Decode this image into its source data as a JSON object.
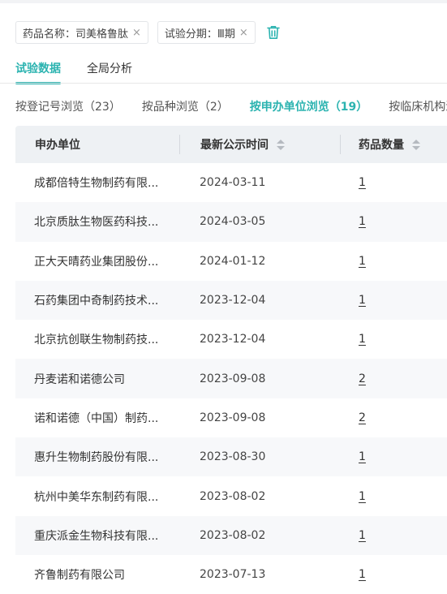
{
  "filters": [
    {
      "label": "药品名称：司美格鲁肽"
    },
    {
      "label": "试验分期：Ⅲ期"
    }
  ],
  "close_glyph": "×",
  "tabs": [
    {
      "label": "试验数据",
      "active": true
    },
    {
      "label": "全局分析",
      "active": false
    }
  ],
  "subtabs": [
    {
      "label": "按登记号浏览（23）"
    },
    {
      "label": "按品种浏览（2）"
    },
    {
      "label": "按申办单位浏览（19）"
    },
    {
      "label": "按临床机构浏览"
    }
  ],
  "table": {
    "columns": [
      "申办单位",
      "最新公示时间",
      "药品数量"
    ],
    "rows": [
      {
        "sponsor": "成都倍特生物制药有限...",
        "date": "2024-03-11",
        "count": "1"
      },
      {
        "sponsor": "北京质肽生物医药科技...",
        "date": "2024-03-05",
        "count": "1"
      },
      {
        "sponsor": "正大天晴药业集团股份...",
        "date": "2024-01-12",
        "count": "1"
      },
      {
        "sponsor": "石药集团中奇制药技术...",
        "date": "2023-12-04",
        "count": "1"
      },
      {
        "sponsor": "北京抗创联生物制药技...",
        "date": "2023-12-04",
        "count": "1"
      },
      {
        "sponsor": "丹麦诺和诺德公司",
        "date": "2023-09-08",
        "count": "2"
      },
      {
        "sponsor": "诺和诺德（中国）制药...",
        "date": "2023-09-08",
        "count": "2"
      },
      {
        "sponsor": "惠升生物制药股份有限...",
        "date": "2023-08-30",
        "count": "1"
      },
      {
        "sponsor": "杭州中美华东制药有限...",
        "date": "2023-08-02",
        "count": "1"
      },
      {
        "sponsor": "重庆派金生物科技有限...",
        "date": "2023-08-02",
        "count": "1"
      },
      {
        "sponsor": "齐鲁制药有限公司",
        "date": "2023-07-13",
        "count": "1"
      }
    ]
  },
  "colors": {
    "accent": "#2bb3b0"
  }
}
